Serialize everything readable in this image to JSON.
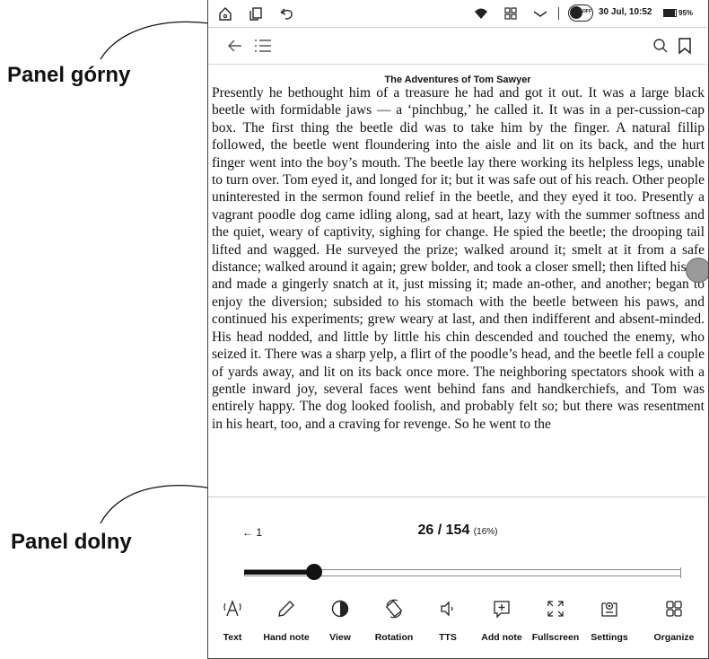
{
  "annotations": {
    "top_label": "Panel górny",
    "bottom_label": "Panel dolny"
  },
  "status_bar": {
    "datetime": "30 Jul, 10:52",
    "battery": "95%",
    "badge": "OFF"
  },
  "book": {
    "title": "The Adventures of Tom Sawyer",
    "text": "Presently he bethought him of a treasure he had and got it out. It was a large black beetle with formidable jaws — a ‘pinchbug,’ he called it. It was in a per-cussion-cap box. The first thing the beetle did was to take him by the finger. A natural fillip followed, the beetle went floundering into the aisle and lit on its back, and the hurt finger went into the boy’s mouth. The beetle lay there working its helpless legs, unable to turn over. Tom eyed it, and longed for it; but it was safe out of his reach. Other people uninterested in the sermon found relief in the beetle, and they eyed it too. Presently a vagrant poodle dog came idling along, sad at heart, lazy with the summer softness and the quiet, weary of captivity, sighing for change. He spied the beetle; the drooping tail lifted and wagged. He surveyed the prize; walked around it; smelt at it from a safe distance; walked around it again; grew bolder, and took a closer smell; then lifted his lip and made a gingerly snatch at it, just missing it; made an-other, and another; began to enjoy the diversion; subsided to his stomach with the beetle between his paws, and continued his experiments; grew weary at last, and then indifferent and absent-minded. His head nodded, and little by little his chin descended and touched the enemy, who seized it. There was a sharp yelp, a flirt of the poodle’s head, and the beetle fell a couple of yards away, and lit on its back once more. The neighboring spectators shook with a gentle inward joy, several faces went behind fans and handkerchiefs, and Tom was entirely happy. The dog looked foolish, and probably felt so; but there was resentment in his heart, too, and a craving for revenge. So he went to the"
  },
  "navigation": {
    "back_page": "← 1",
    "page_current": "26 / 154",
    "percent": "(16%)",
    "progress_fraction": 0.16
  },
  "toolbar": {
    "items": [
      {
        "label": "Text",
        "icon": "text-icon"
      },
      {
        "label": "Hand note",
        "icon": "pencil-icon"
      },
      {
        "label": "View",
        "icon": "view-icon"
      },
      {
        "label": "Rotation",
        "icon": "rotation-icon"
      },
      {
        "label": "TTS",
        "icon": "speaker-icon"
      },
      {
        "label": "Add note",
        "icon": "add-note-icon"
      },
      {
        "label": "Fullscreen",
        "icon": "fullscreen-icon"
      },
      {
        "label": "Settings",
        "icon": "settings-icon"
      },
      {
        "label": "Organize",
        "icon": "grid-icon"
      }
    ]
  }
}
